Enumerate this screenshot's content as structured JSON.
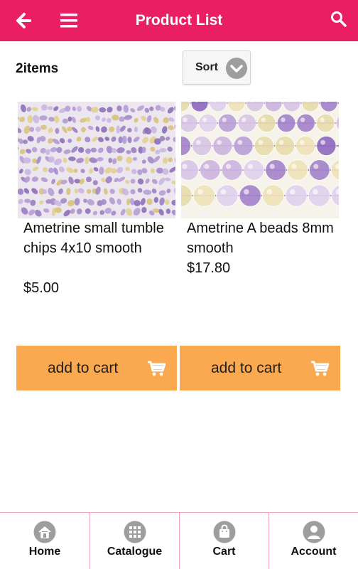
{
  "header": {
    "title": "Product List",
    "background": "#e91e63",
    "back_icon": "arrow-left-icon",
    "menu_icon": "hamburger-menu-icon",
    "search_icon": "search-icon"
  },
  "listing": {
    "count_label": "2items",
    "sort_label": "Sort",
    "sort_icon": "chevron-down-icon"
  },
  "products": [
    {
      "name": "Ametrine small tumble chips 4x10 smooth",
      "price": "$5.00",
      "image": "ametrine-chips-strands",
      "add_label": "add to cart"
    },
    {
      "name": "Ametrine A beads 8mm smooth",
      "price": "$17.80",
      "image": "ametrine-round-beads-strands",
      "add_label": "add to cart"
    }
  ],
  "add_button_color": "#fba950",
  "bottom_nav": [
    {
      "label": "Home",
      "icon": "home-icon"
    },
    {
      "label": "Catalogue",
      "icon": "grid-icon"
    },
    {
      "label": "Cart",
      "icon": "shopping-bag-icon"
    },
    {
      "label": "Account",
      "icon": "user-icon"
    }
  ]
}
